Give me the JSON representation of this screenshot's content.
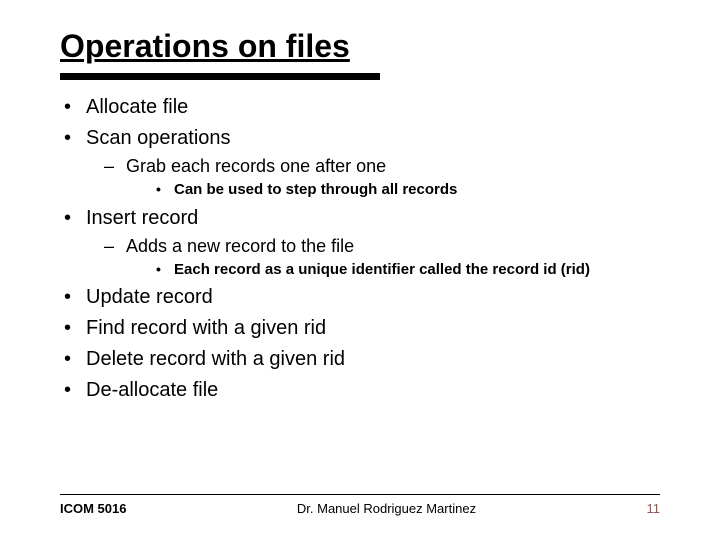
{
  "title": "Operations on files",
  "b1": "Allocate file",
  "b2": "Scan operations",
  "b2_1": "Grab each records one after one",
  "b2_1_1": "Can be used to step through all records",
  "b3": "Insert record",
  "b3_1": "Adds a new record to the file",
  "b3_1_1": "Each record as a unique identifier called the record id (rid)",
  "b4": "Update record",
  "b5": "Find record with a given rid",
  "b6": "Delete record with a given rid",
  "b7": "De-allocate file",
  "footer_left": "ICOM 5016",
  "footer_center": "Dr. Manuel Rodriguez Martinez",
  "footer_right": "11"
}
